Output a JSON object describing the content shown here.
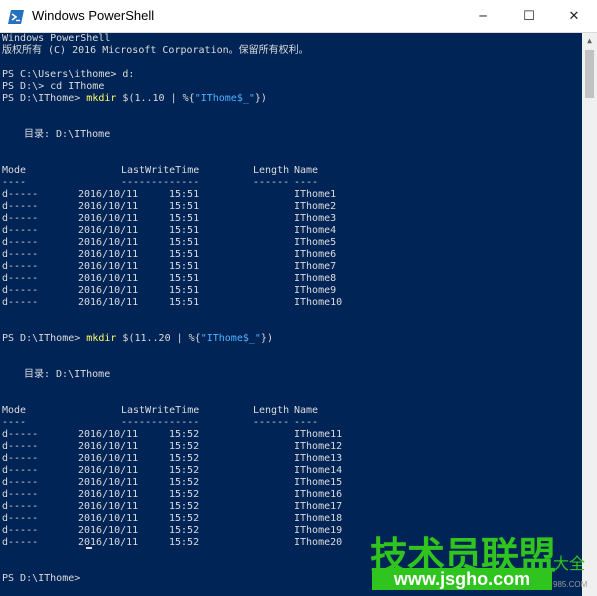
{
  "window": {
    "title": "Windows PowerShell",
    "minimize_glyph": "─",
    "maximize_glyph": "☐",
    "close_glyph": "✕",
    "icon": "powershell-icon"
  },
  "colors": {
    "console_bg": "#012456",
    "console_text": "#dcdcdc",
    "keyword": "#ffff66",
    "string": "#4fb3ff",
    "watermark": "#2fc41e"
  },
  "console": {
    "header": [
      "Windows PowerShell",
      "版权所有 (C) 2016 Microsoft Corporation。保留所有权利。"
    ],
    "cmd1": "PS C:\\Users\\ithome> d:",
    "cmd2": "PS D:\\> cd IThome",
    "cmd3": {
      "prompt": "PS D:\\IThome> ",
      "kw": "mkdir",
      "a": " $(1..10 | %{",
      "str": "\"IThome$_\"",
      "b": "})"
    },
    "cmd4": {
      "prompt": "PS D:\\IThome> ",
      "kw": "mkdir",
      "a": " $(11..20 | %{",
      "str": "\"IThome$_\"",
      "b": "})"
    },
    "dir_label": "目录: D:\\IThome",
    "headers": {
      "mode": "Mode",
      "time": "LastWriteTime",
      "length": "Length",
      "name": "Name"
    },
    "underline": {
      "mode": "----",
      "time": "-------------",
      "length": "------",
      "name": "----"
    },
    "block1": [
      {
        "mode": "d-----",
        "date": "2016/10/11",
        "time": "15:51",
        "name": "IThome1"
      },
      {
        "mode": "d-----",
        "date": "2016/10/11",
        "time": "15:51",
        "name": "IThome2"
      },
      {
        "mode": "d-----",
        "date": "2016/10/11",
        "time": "15:51",
        "name": "IThome3"
      },
      {
        "mode": "d-----",
        "date": "2016/10/11",
        "time": "15:51",
        "name": "IThome4"
      },
      {
        "mode": "d-----",
        "date": "2016/10/11",
        "time": "15:51",
        "name": "IThome5"
      },
      {
        "mode": "d-----",
        "date": "2016/10/11",
        "time": "15:51",
        "name": "IThome6"
      },
      {
        "mode": "d-----",
        "date": "2016/10/11",
        "time": "15:51",
        "name": "IThome7"
      },
      {
        "mode": "d-----",
        "date": "2016/10/11",
        "time": "15:51",
        "name": "IThome8"
      },
      {
        "mode": "d-----",
        "date": "2016/10/11",
        "time": "15:51",
        "name": "IThome9"
      },
      {
        "mode": "d-----",
        "date": "2016/10/11",
        "time": "15:51",
        "name": "IThome10"
      }
    ],
    "block2": [
      {
        "mode": "d-----",
        "date": "2016/10/11",
        "time": "15:52",
        "name": "IThome11"
      },
      {
        "mode": "d-----",
        "date": "2016/10/11",
        "time": "15:52",
        "name": "IThome12"
      },
      {
        "mode": "d-----",
        "date": "2016/10/11",
        "time": "15:52",
        "name": "IThome13"
      },
      {
        "mode": "d-----",
        "date": "2016/10/11",
        "time": "15:52",
        "name": "IThome14"
      },
      {
        "mode": "d-----",
        "date": "2016/10/11",
        "time": "15:52",
        "name": "IThome15"
      },
      {
        "mode": "d-----",
        "date": "2016/10/11",
        "time": "15:52",
        "name": "IThome16"
      },
      {
        "mode": "d-----",
        "date": "2016/10/11",
        "time": "15:52",
        "name": "IThome17"
      },
      {
        "mode": "d-----",
        "date": "2016/10/11",
        "time": "15:52",
        "name": "IThome18"
      },
      {
        "mode": "d-----",
        "date": "2016/10/11",
        "time": "15:52",
        "name": "IThome19"
      },
      {
        "mode": "d-----",
        "date": "2016/10/11",
        "time": "15:52",
        "name": "IThome20"
      }
    ],
    "final_prompt": "PS D:\\IThome> "
  },
  "watermark": {
    "cn": "技术员联盟",
    "url": "www.jsgho.com",
    "side": "大全",
    "small": "985.COM"
  }
}
